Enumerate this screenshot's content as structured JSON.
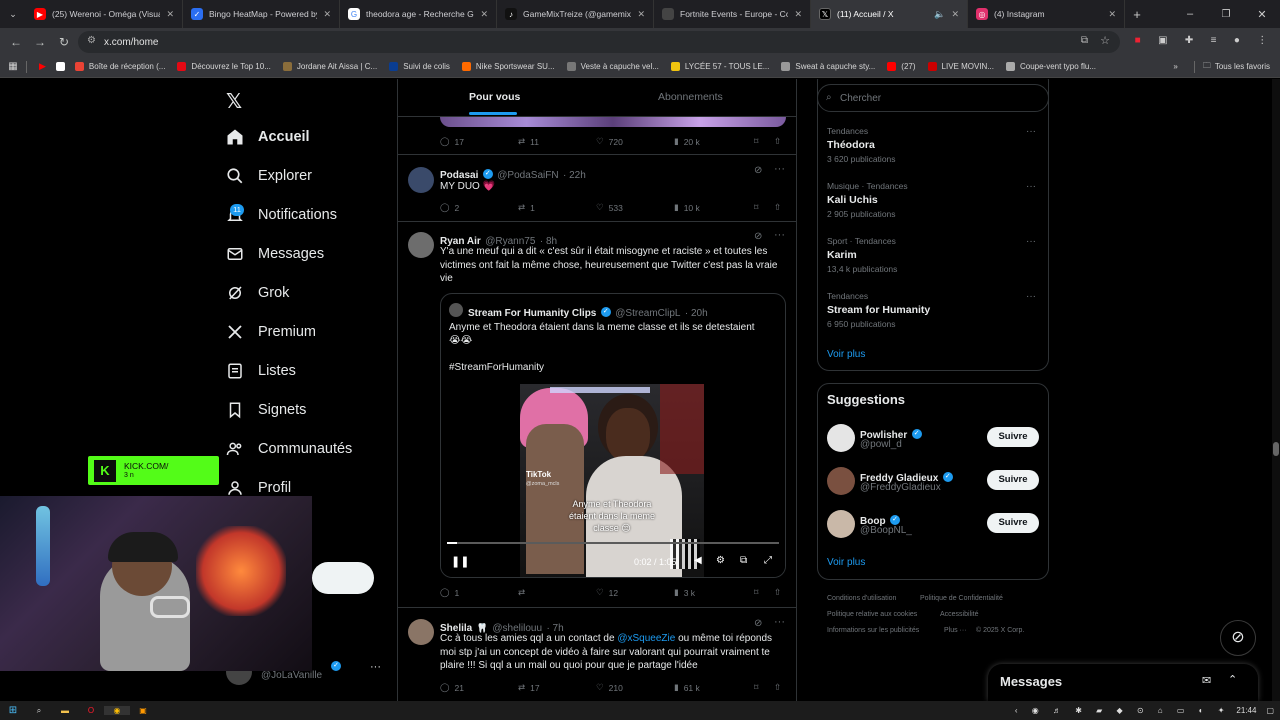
{
  "browser": {
    "tabs": [
      {
        "label": "(25) Werenoi - Oméga (Visualiz",
        "color": "#ff0000"
      },
      {
        "label": "Bingo HeatMap - Powered by V",
        "color": "#2b6ef2"
      },
      {
        "label": "theodora age - Recherche Goo",
        "color": "#4285f4"
      },
      {
        "label": "GameMixTreize (@gamemixtre",
        "color": "#111111"
      },
      {
        "label": "Fortnite Events - Europe - Com",
        "color": "#3a3a3a"
      },
      {
        "label": "(11) Accueil / X",
        "color": "#000000",
        "active": true
      },
      {
        "label": "(4) Instagram",
        "color": "#e1306c"
      }
    ],
    "url": "x.com/home",
    "bookmarks": [
      {
        "label": "Boîte de réception (...",
        "color": "#ea4335"
      },
      {
        "label": "Découvrez le Top 10...",
        "color": "#e50914"
      },
      {
        "label": "Jordane Ait Aissa | C...",
        "color": "#8a6d3b"
      },
      {
        "label": "Suivi de colis",
        "color": "#0a3d91"
      },
      {
        "label": "Nike Sportswear SU...",
        "color": "#ff6a00"
      },
      {
        "label": "Veste à capuche vel...",
        "color": "#777777"
      },
      {
        "label": "LYCÉE 57 - TOUS LE...",
        "color": "#f1c40f"
      },
      {
        "label": "Sweat à capuche sty...",
        "color": "#999999"
      },
      {
        "label": "(27)",
        "color": "#ff0000"
      },
      {
        "label": "LIVE MOVIN...",
        "color": "#cc0000"
      },
      {
        "label": "Coupe-vent typo flu...",
        "color": "#aaaaaa"
      }
    ],
    "all_bookmarks": "Tous les favoris"
  },
  "sidebar": {
    "items": [
      {
        "label": "Accueil",
        "icon": "home-icon"
      },
      {
        "label": "Explorer",
        "icon": "search-icon"
      },
      {
        "label": "Notifications",
        "icon": "bell-icon",
        "badge": "11"
      },
      {
        "label": "Messages",
        "icon": "envelope-icon"
      },
      {
        "label": "Grok",
        "icon": "grok-icon"
      },
      {
        "label": "Premium",
        "icon": "x-logo-icon"
      },
      {
        "label": "Listes",
        "icon": "list-icon"
      },
      {
        "label": "Signets",
        "icon": "bookmark-icon"
      },
      {
        "label": "Communautés",
        "icon": "people-icon"
      },
      {
        "label": "Profil",
        "icon": "person-icon"
      }
    ],
    "account_handle": "@JoLaVanille",
    "kick_overlay": {
      "label": "KICK.COM/",
      "sub": "3 n"
    }
  },
  "feed": {
    "tabs": [
      "Pour vous",
      "Abonnements"
    ],
    "top_actions": {
      "replies": "17",
      "reposts": "11",
      "likes": "720",
      "views": "20 k"
    },
    "tweets": [
      {
        "name": "Podasai",
        "handle": "@PodaSaiFN",
        "time": "· 22h",
        "text": "MY DUO 💗",
        "replies": "2",
        "reposts": "1",
        "likes": "533",
        "views": "10 k"
      },
      {
        "name": "Ryan Air",
        "handle": "@Ryann75",
        "time": "· 8h",
        "text": "Y'a une meuf qui a dit « c'est sûr il était misogyne et raciste » et toutes les victimes ont fait la même chose, heureusement que Twitter c'est pas la vraie vie",
        "quote": {
          "name": "Stream For Humanity Clips",
          "handle": "@StreamClipL",
          "time": "· 20h",
          "text": "Anyme et Theodora étaient dans la meme classe et ils se detestaient",
          "emoji": "😭😭",
          "hashtag": "#StreamForHumanity",
          "video_caption": "Anyme et Theodora étaient dans la meme classe 😒",
          "tiktok_label": "TikTok",
          "tiktok_handle": "@zoma_mcls",
          "video_time": "0:02 / 1:05",
          "progress": 0.03
        },
        "replies": "1",
        "reposts": "",
        "likes": "12",
        "views": "3 k"
      },
      {
        "name": "Shelila",
        "handle": "@shelilouu",
        "time": "· 7h",
        "text_before": "Cc à tous les amies qql a un contact de ",
        "mention": "@xSqueeZie",
        "text_after": " ou même toi réponds moi stp j'ai un concept de vidéo à faire sur valorant qui pourrait vraiment te plaire !!! Si qql a un mail ou quoi pour que je partage l'idée",
        "replies": "21",
        "reposts": "17",
        "likes": "210",
        "views": "61 k"
      }
    ]
  },
  "right": {
    "search_placeholder": "Chercher",
    "trends": [
      {
        "meta": "Tendances",
        "name": "Théodora",
        "count": "3 620 publications"
      },
      {
        "meta": "Musique · Tendances",
        "name": "Kali Uchis",
        "count": "2 905 publications"
      },
      {
        "meta": "Sport · Tendances",
        "name": "Karim",
        "count": "13,4 k publications"
      },
      {
        "meta": "Tendances",
        "name": "Stream for Humanity",
        "count": "6 950 publications"
      }
    ],
    "see_more": "Voir plus",
    "suggestions_title": "Suggestions",
    "suggestions": [
      {
        "name": "Powlisher",
        "handle": "@powl_d"
      },
      {
        "name": "Freddy Gladieux",
        "handle": "@FreddyGladieux"
      },
      {
        "name": "Boop",
        "handle": "@BoopNL_"
      }
    ],
    "follow_label": "Suivre",
    "see_more_2": "Voir plus",
    "footer": [
      "Conditions d'utilisation",
      "Politique de Confidentialité",
      "Politique relative aux cookies",
      "Accessibilité",
      "Informations sur les publicités",
      "Plus ···",
      "© 2025 X Corp."
    ],
    "messages_label": "Messages"
  },
  "taskbar": {
    "time": "21:44"
  }
}
